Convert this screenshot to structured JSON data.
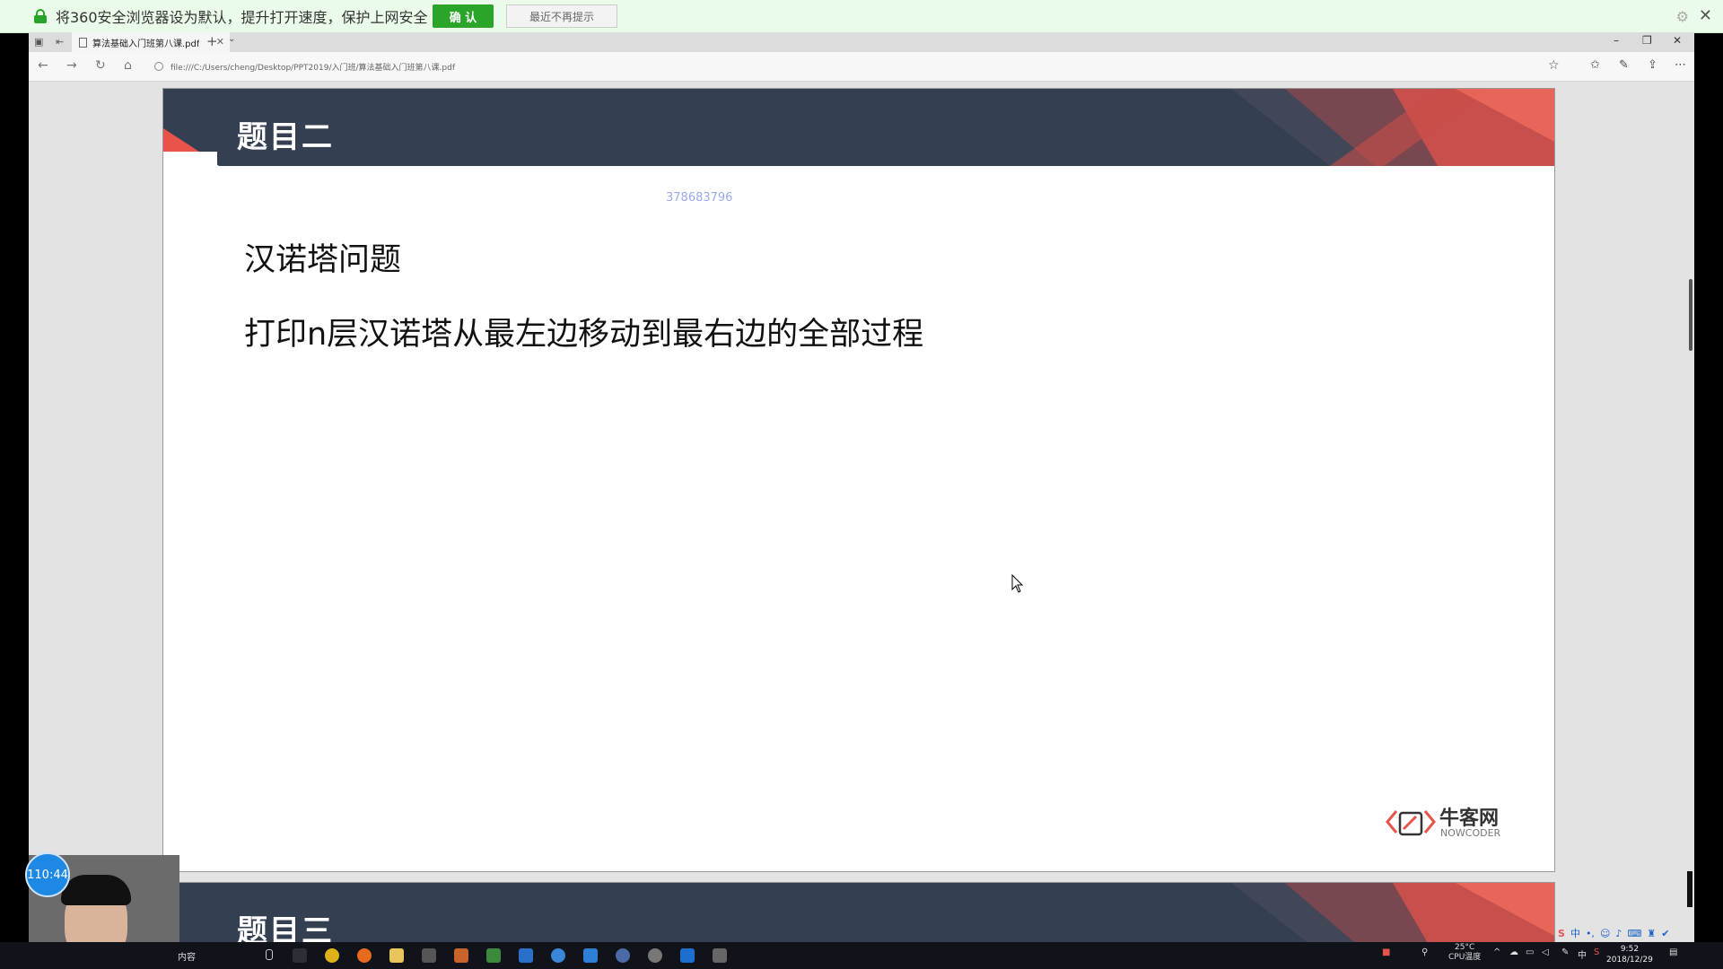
{
  "notification": {
    "message": "将360安全浏览器设为默认，提升打开速度，保护上网安全",
    "confirm_label": "确 认",
    "dismiss_label": "最近不再提示"
  },
  "browser": {
    "tab_title": "算法基础入门班第八课.pdf",
    "url": "file:///C:/Users/cheng/Desktop/PPT2019/入门班/算法基础入门班第八课.pdf"
  },
  "slide1": {
    "title": "题目二",
    "watermark": "378683796",
    "question_title": "汉诺塔问题",
    "question_desc": "打印n层汉诺塔从最左边移动到最右边的全部过程",
    "logo_text": "牛客网",
    "logo_sub": "NOWCODER"
  },
  "slide2": {
    "title": "题目三"
  },
  "overlay": {
    "timer": "110:44"
  },
  "taskbar": {
    "search_placeholder": "内容",
    "temp": "25°C",
    "temp_label": "CPU温度",
    "time": "9:52",
    "date": "2018/12/29",
    "ime_lang": "中"
  },
  "colors": {
    "slide_header": "#343f52",
    "accent_red": "#e8544a",
    "confirm_green": "#2aa52a"
  }
}
